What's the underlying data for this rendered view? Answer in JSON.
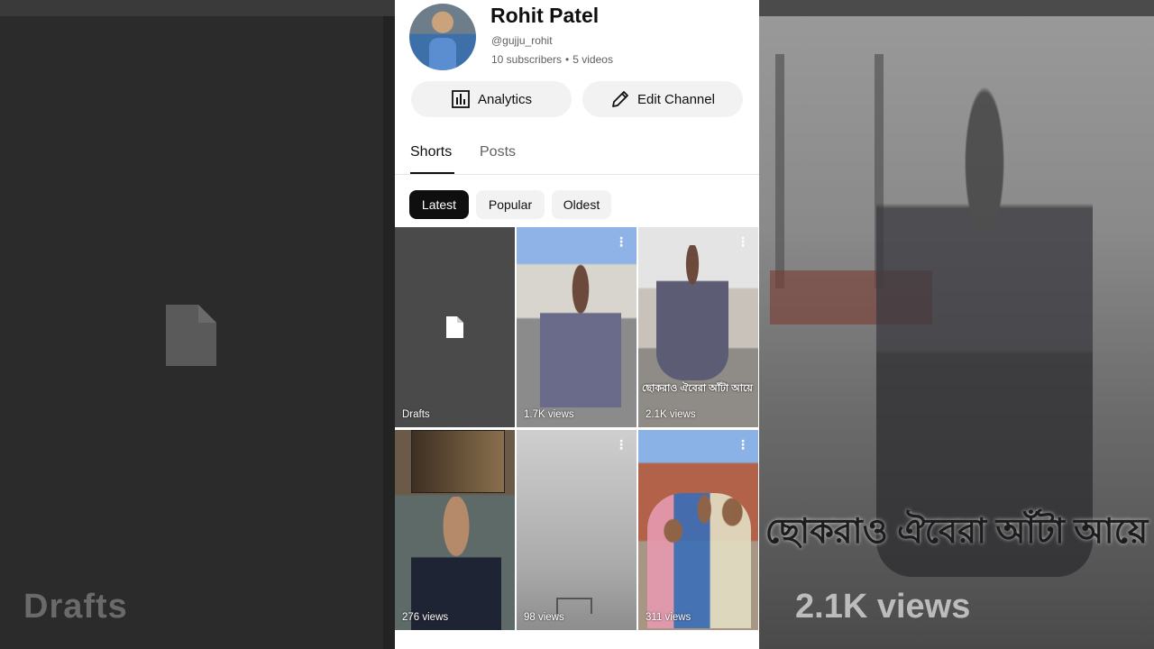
{
  "channel": {
    "name": "Rohit Patel",
    "handle": "@gujju_rohit",
    "subscribers": "10 subscribers",
    "videos": "5 videos",
    "separator": "•"
  },
  "actions": {
    "analytics_label": "Analytics",
    "edit_label": "Edit Channel"
  },
  "tabs": [
    {
      "label": "Shorts",
      "active": true
    },
    {
      "label": "Posts",
      "active": false
    }
  ],
  "filters": [
    {
      "label": "Latest",
      "selected": true
    },
    {
      "label": "Popular",
      "selected": false
    },
    {
      "label": "Oldest",
      "selected": false
    }
  ],
  "shorts": [
    {
      "label": "Drafts",
      "kind": "drafts"
    },
    {
      "label": "1.7K views",
      "kind": "video"
    },
    {
      "label": "2.1K views",
      "kind": "video",
      "overlay_text": "ছোকরাও ঐবেরা আঁটা আয়ে"
    },
    {
      "label": "276 views",
      "kind": "video"
    },
    {
      "label": "98 views",
      "kind": "video"
    },
    {
      "label": "311 views",
      "kind": "video"
    }
  ],
  "background": {
    "left_label": "Drafts",
    "right_label": "2.1K views",
    "right_caption": "ছোকরাও ঐবেরা আঁটা আয়ে"
  },
  "colors": {
    "chip_selected_bg": "#0f0f0f",
    "chip_bg": "#f2f2f2",
    "text_primary": "#0f0f0f",
    "text_secondary": "#606060"
  }
}
